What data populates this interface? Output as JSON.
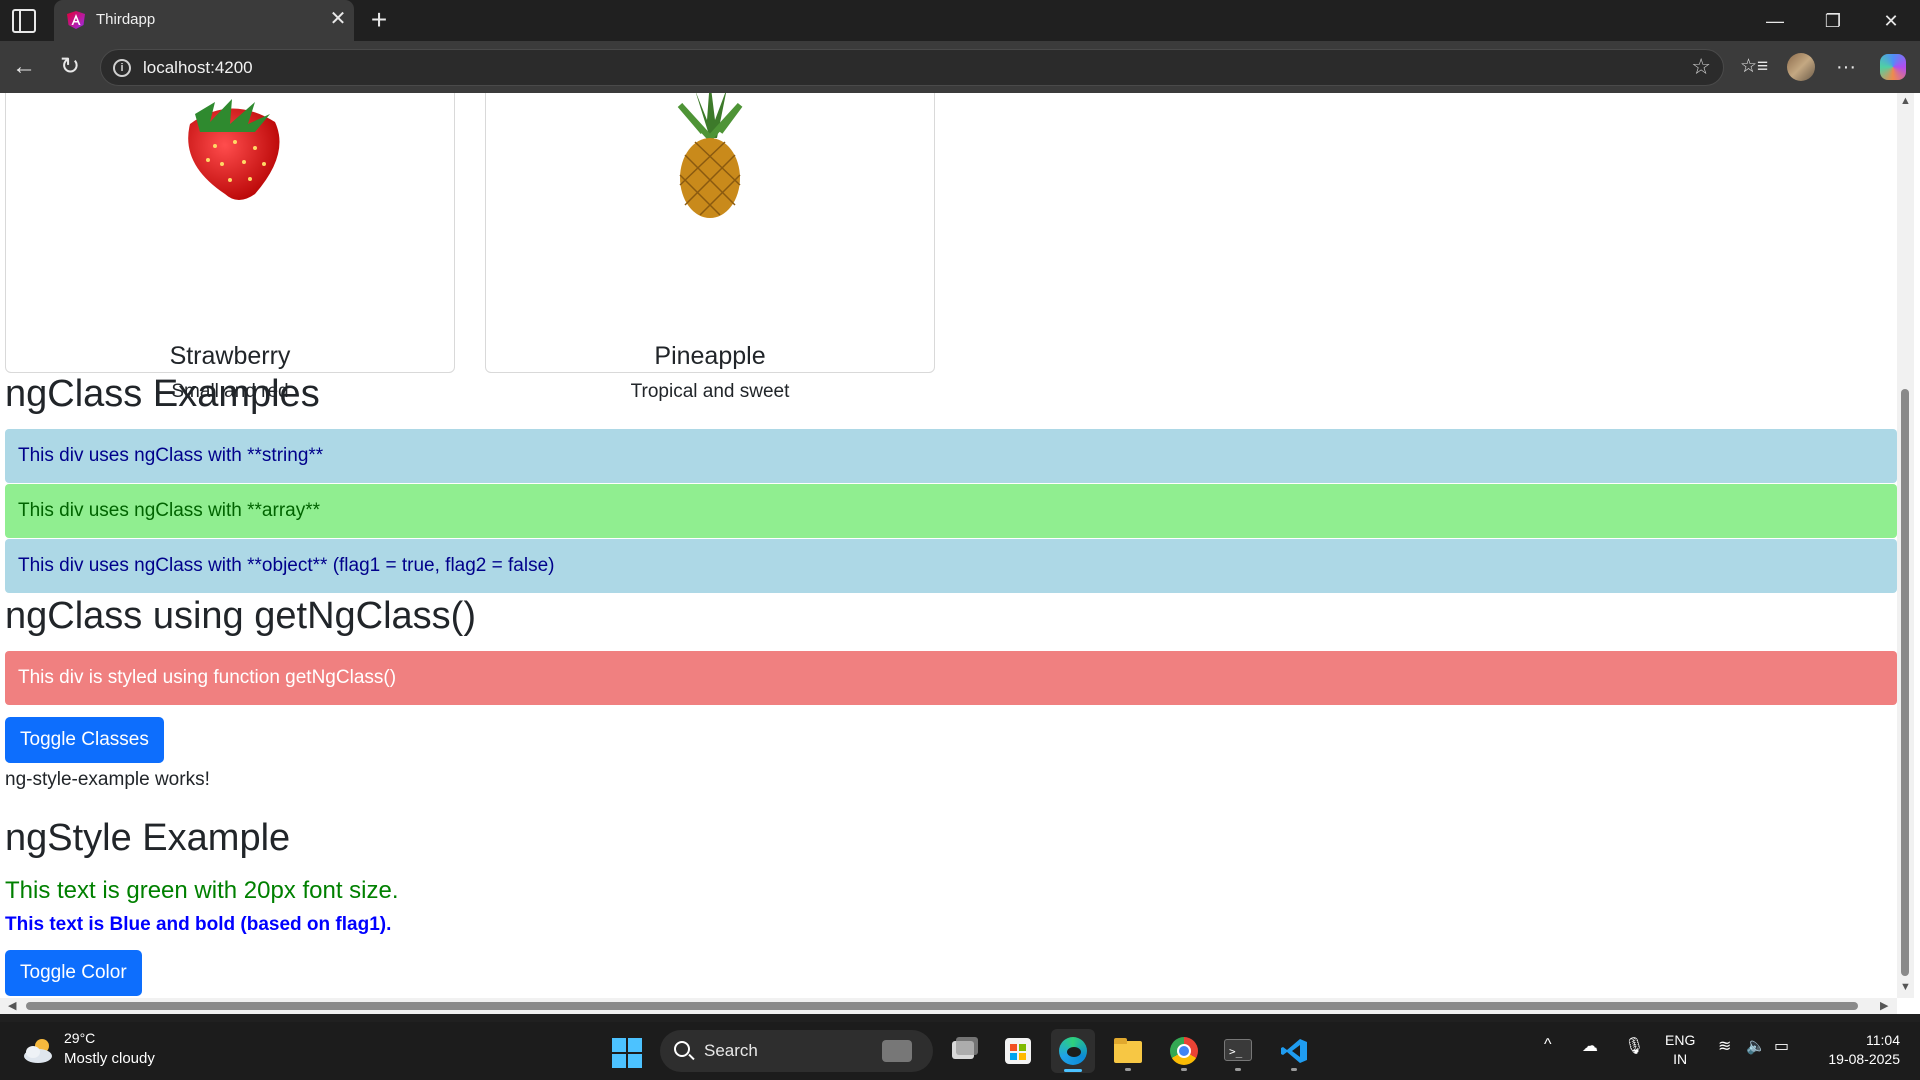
{
  "browser": {
    "tab_title": "Thirdapp",
    "tab_close": "✕",
    "new_tab": "+",
    "url": "localhost:4200",
    "minimize": "—",
    "maximize": "❐",
    "close": "✕",
    "back": "←",
    "reload": "↻",
    "star": "☆",
    "favorites": "☆≡",
    "more": "···"
  },
  "cards": [
    {
      "title": "Strawberry",
      "description": "Small and red"
    },
    {
      "title": "Pineapple",
      "description": "Tropical and sweet"
    }
  ],
  "ngclass": {
    "heading": "ngClass Examples",
    "string_div": "This div uses ngClass with **string**",
    "array_div": "This div uses ngClass with **array**",
    "object_div": "This div uses ngClass with **object** (flag1 = true, flag2 = false)"
  },
  "getngclass": {
    "heading": "ngClass using getNgClass()",
    "styled_div": "This div is styled using function getNgClass()",
    "toggle_button": "Toggle Classes"
  },
  "ngstyle": {
    "works_text": "ng-style-example works!",
    "heading": "ngStyle Example",
    "green_text": "This text is green with 20px font size.",
    "blue_text": "This text is Blue and bold (based on flag1).",
    "toggle_button": "Toggle Color"
  },
  "taskbar": {
    "temperature": "29°C",
    "condition": "Mostly cloudy",
    "search_label": "Search",
    "lang_line1": "ENG",
    "lang_line2": "IN",
    "time": "11:04",
    "date": "19-08-2025",
    "chevron": "^"
  },
  "colors": {
    "bar_blue": "#add8e6",
    "bar_green": "#90ee90",
    "bar_red": "#f08080",
    "button_blue": "#0d6efd",
    "green_text": "#008000",
    "blue_text": "#0000ff"
  }
}
